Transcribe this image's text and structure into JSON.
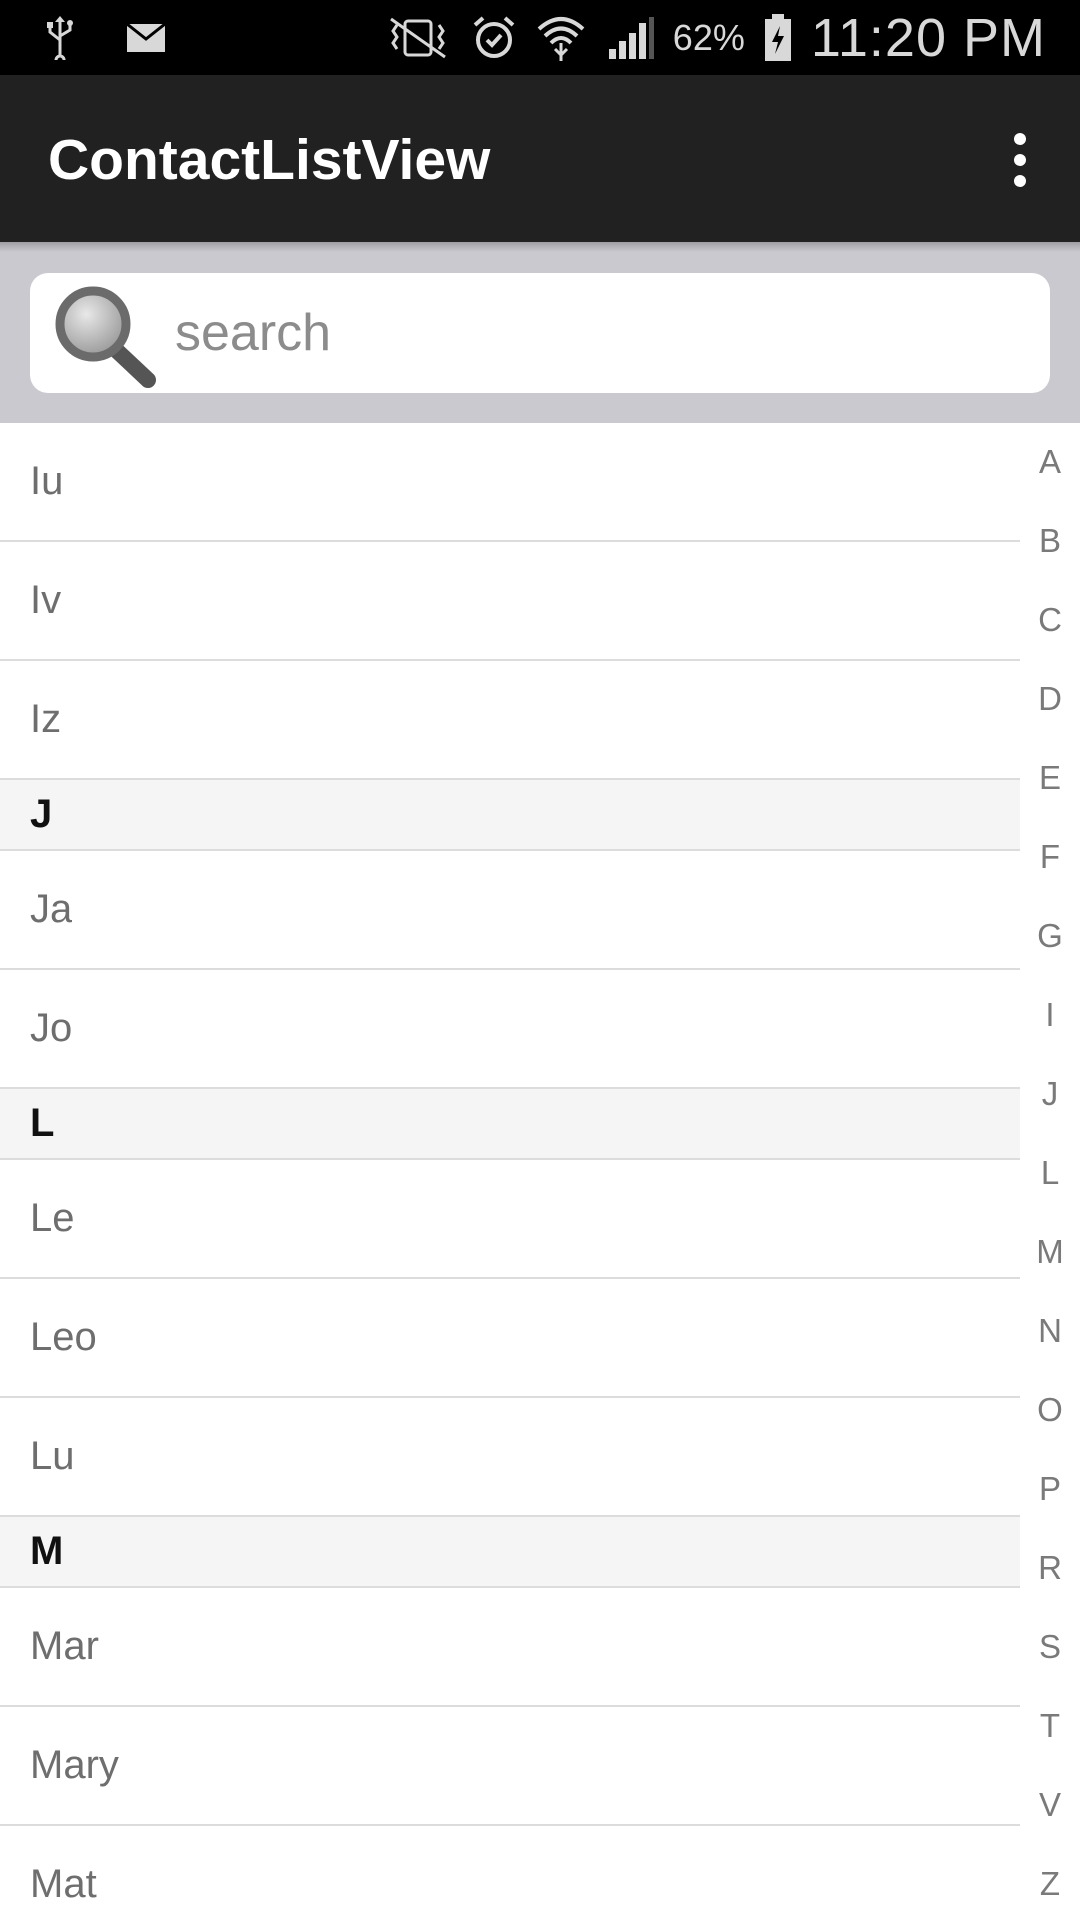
{
  "status_bar": {
    "battery_percent": "62%",
    "time": "11:20 PM",
    "icons": [
      "usb-icon",
      "mail-icon",
      "vibrate-mute-icon",
      "alarm-icon",
      "wifi-icon",
      "signal-icon",
      "battery-charging-icon"
    ]
  },
  "app_bar": {
    "title": "ContactListView",
    "menu_icon": "overflow-menu-icon"
  },
  "search": {
    "placeholder": "search",
    "value": "",
    "icon": "magnifier-icon"
  },
  "list": {
    "items": [
      {
        "type": "item",
        "name": "Iu"
      },
      {
        "type": "item",
        "name": "Iv"
      },
      {
        "type": "item",
        "name": "Iz"
      },
      {
        "type": "header",
        "name": "J"
      },
      {
        "type": "item",
        "name": "Ja"
      },
      {
        "type": "item",
        "name": "Jo"
      },
      {
        "type": "header",
        "name": "L"
      },
      {
        "type": "item",
        "name": "Le"
      },
      {
        "type": "item",
        "name": "Leo"
      },
      {
        "type": "item",
        "name": "Lu"
      },
      {
        "type": "header",
        "name": "M"
      },
      {
        "type": "item",
        "name": "Mar"
      },
      {
        "type": "item",
        "name": "Mary"
      },
      {
        "type": "item",
        "name": "Mat"
      }
    ]
  },
  "index_bar": {
    "letters": [
      "A",
      "B",
      "C",
      "D",
      "E",
      "F",
      "G",
      "I",
      "J",
      "L",
      "M",
      "N",
      "O",
      "P",
      "R",
      "S",
      "T",
      "V",
      "Z"
    ]
  },
  "colors": {
    "app_bar": "#212121",
    "status_bar": "#000000",
    "search_background": "#c9c9cf",
    "header_background": "#f5f5f5"
  }
}
